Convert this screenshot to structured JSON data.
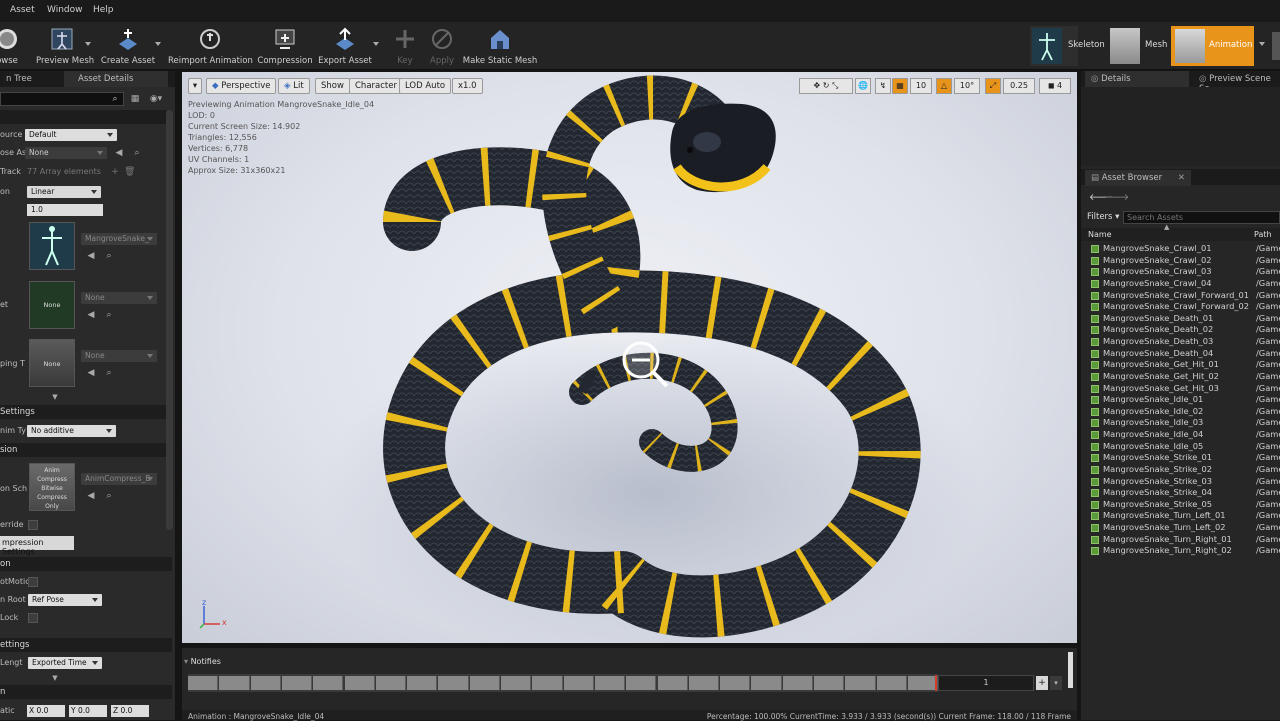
{
  "menu": {
    "items": [
      "Asset",
      "Window",
      "Help"
    ]
  },
  "toolbar": {
    "buttons": [
      {
        "label": "owse"
      },
      {
        "label": "Preview Mesh"
      },
      {
        "label": "Create Asset"
      },
      {
        "label": "Reimport Animation"
      },
      {
        "label": "Compression"
      },
      {
        "label": "Export Asset"
      },
      {
        "label": "Key"
      },
      {
        "label": "Apply"
      },
      {
        "label": "Make Static Mesh"
      }
    ],
    "modes": [
      {
        "label": "Skeleton"
      },
      {
        "label": "Mesh"
      },
      {
        "label": "Animation"
      }
    ]
  },
  "left_panel": {
    "tabs": [
      "n Tree",
      "Asset Details"
    ],
    "rows": {
      "source_label": "ource",
      "source_value": "Default",
      "pose_label": "ose As",
      "pose_value": "None",
      "track_label": "Track",
      "track_value": "77 Array elements",
      "interp_label": "on",
      "interp_value": "Linear",
      "rate_value": "1.0",
      "skeleton_value": "MangroveSnake_",
      "none1_thumb": "None",
      "none1_value": "None",
      "none1_label": "et",
      "none2_thumb": "None",
      "none2_value": "None",
      "none2_label": "ping T"
    },
    "sections": {
      "settings1": "Settings",
      "additive_label": "nim Ty",
      "additive_value": "No additive",
      "compression": "sion",
      "compress_label": "on Sch",
      "compress_thumb": "Anim Compress Bitwise Compress Only",
      "compress_value": "AnimCompress_B",
      "override_label": "erride",
      "compression_button": "mpression Settings",
      "section3": "on",
      "root_motion_label": "otMotio",
      "root_label": "n Root",
      "root_value": "Ref Pose",
      "lock_label": "Lock",
      "section4": "ettings",
      "length_label": "Lengt",
      "length_value": "Exported Time",
      "section5": "n",
      "xyz_label": "atic",
      "x": "X 0.0",
      "y": "Y 0.0",
      "z": "Z 0.0"
    }
  },
  "viewport": {
    "buttons": [
      "Perspective",
      "Lit",
      "Show",
      "Character",
      "LOD Auto",
      "x1.0"
    ],
    "stats": [
      "Previewing Animation MangroveSnake_Idle_04",
      "LOD: 0",
      "Current Screen Size: 14.902",
      "Triangles: 12,556",
      "Vertices: 6,778",
      "UV Channels: 1",
      "Approx Size: 31x360x21"
    ],
    "snap": {
      "grid": "10",
      "rot": "10°",
      "scale": "0.25",
      "cam": "4"
    },
    "axis": {
      "x": "x",
      "z": "z"
    }
  },
  "right_panel": {
    "tabs": [
      "Details",
      "Preview Scene Se"
    ],
    "asset_browser_tab": "Asset Browser",
    "filters_label": "Filters",
    "search_placeholder": "Search Assets",
    "col_name": "Name",
    "col_path": "Path",
    "path_value": "/Game",
    "assets": [
      "MangroveSnake_Crawl_01",
      "MangroveSnake_Crawl_02",
      "MangroveSnake_Crawl_03",
      "MangroveSnake_Crawl_04",
      "MangroveSnake_Crawl_Forward_01",
      "MangroveSnake_Crawl_Forward_02",
      "MangroveSnake_Death_01",
      "MangroveSnake_Death_02",
      "MangroveSnake_Death_03",
      "MangroveSnake_Death_04",
      "MangroveSnake_Get_Hit_01",
      "MangroveSnake_Get_Hit_02",
      "MangroveSnake_Get_Hit_03",
      "MangroveSnake_Idle_01",
      "MangroveSnake_Idle_02",
      "MangroveSnake_Idle_03",
      "MangroveSnake_Idle_04",
      "MangroveSnake_Idle_05",
      "MangroveSnake_Strike_01",
      "MangroveSnake_Strike_02",
      "MangroveSnake_Strike_03",
      "MangroveSnake_Strike_04",
      "MangroveSnake_Strike_05",
      "MangroveSnake_Turn_Left_01",
      "MangroveSnake_Turn_Left_02",
      "MangroveSnake_Turn_Right_01",
      "MangroveSnake_Turn_Right_02"
    ]
  },
  "timeline": {
    "notifies_label": "Notifies",
    "frame_value": "1",
    "progress": 0.99,
    "status_left": "Animation : MangroveSnake_Idle_04",
    "status_right": "Percentage: 100.00% CurrentTime: 3.933 / 3.933 (second(s)) Current Frame: 118.00 / 118 Frame"
  },
  "colors": {
    "accent_orange": "#e8931a",
    "snake_black": "#1c1f26",
    "snake_yellow": "#f3c21a"
  }
}
